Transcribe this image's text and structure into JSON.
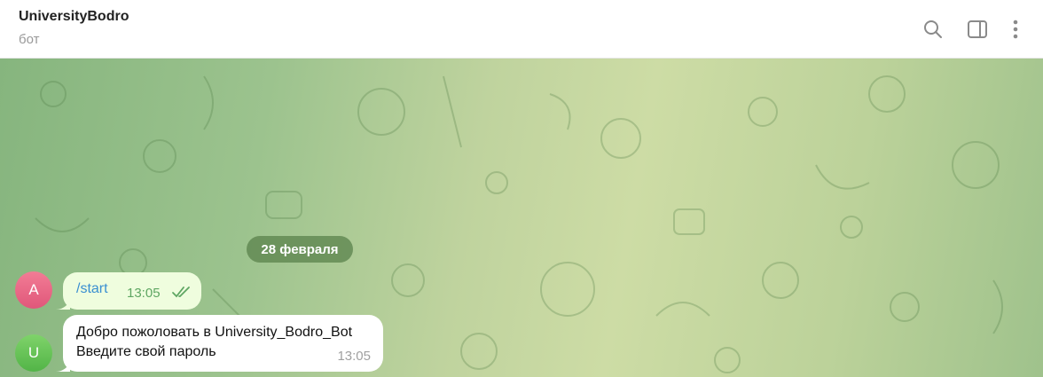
{
  "header": {
    "title": "UniversityBodro",
    "subtitle": "бот",
    "icons": [
      "search-icon",
      "sidebar-toggle-icon",
      "more-vertical-icon"
    ]
  },
  "chat": {
    "date_separator": "28 февраля",
    "messages": [
      {
        "avatar_letter": "A",
        "avatar_color": "#e86987",
        "text": "/start",
        "time": "13:05",
        "status": "read",
        "outgoing": true
      },
      {
        "avatar_letter": "U",
        "avatar_color": "#62c04f",
        "lines": [
          "Добро пожоловать в University_Bodro_Bot",
          "Введите свой пароль"
        ],
        "time": "13:05",
        "outgoing": false
      }
    ]
  },
  "colors": {
    "accent": "#3a8fd1",
    "outgoing_bubble": "#effdde",
    "read_checks": "#5ea662"
  }
}
